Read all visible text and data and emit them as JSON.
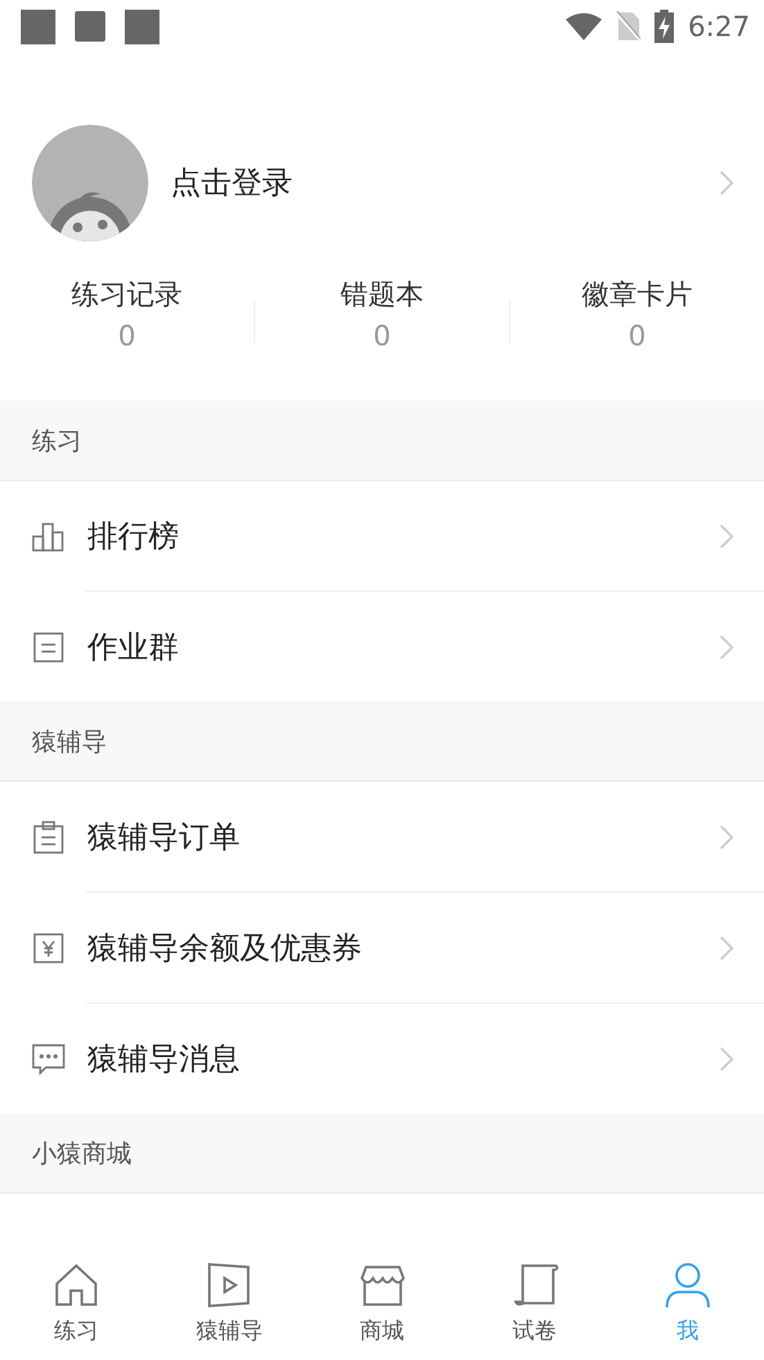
{
  "status_bar": {
    "time": "6:27"
  },
  "profile": {
    "login_text": "点击登录"
  },
  "stats": [
    {
      "label": "练习记录",
      "count": "0"
    },
    {
      "label": "错题本",
      "count": "0"
    },
    {
      "label": "徽章卡片",
      "count": "0"
    }
  ],
  "sections": [
    {
      "title": "练习",
      "items": [
        {
          "label": "排行榜",
          "kind": "chart"
        },
        {
          "label": "作业群",
          "kind": "list"
        }
      ]
    },
    {
      "title": "猿辅导",
      "items": [
        {
          "label": "猿辅导订单",
          "kind": "clipboard"
        },
        {
          "label": "猿辅导余额及优惠券",
          "kind": "yen"
        },
        {
          "label": "猿辅导消息",
          "kind": "message"
        }
      ]
    },
    {
      "title": "小猿商城"
    }
  ],
  "tabs": [
    {
      "label": "练习",
      "kind": "home",
      "selected": false
    },
    {
      "label": "猿辅导",
      "kind": "video",
      "selected": false
    },
    {
      "label": "商城",
      "kind": "store",
      "selected": false
    },
    {
      "label": "试卷",
      "kind": "scroll",
      "selected": false
    },
    {
      "label": "我",
      "kind": "person",
      "selected": true
    }
  ]
}
